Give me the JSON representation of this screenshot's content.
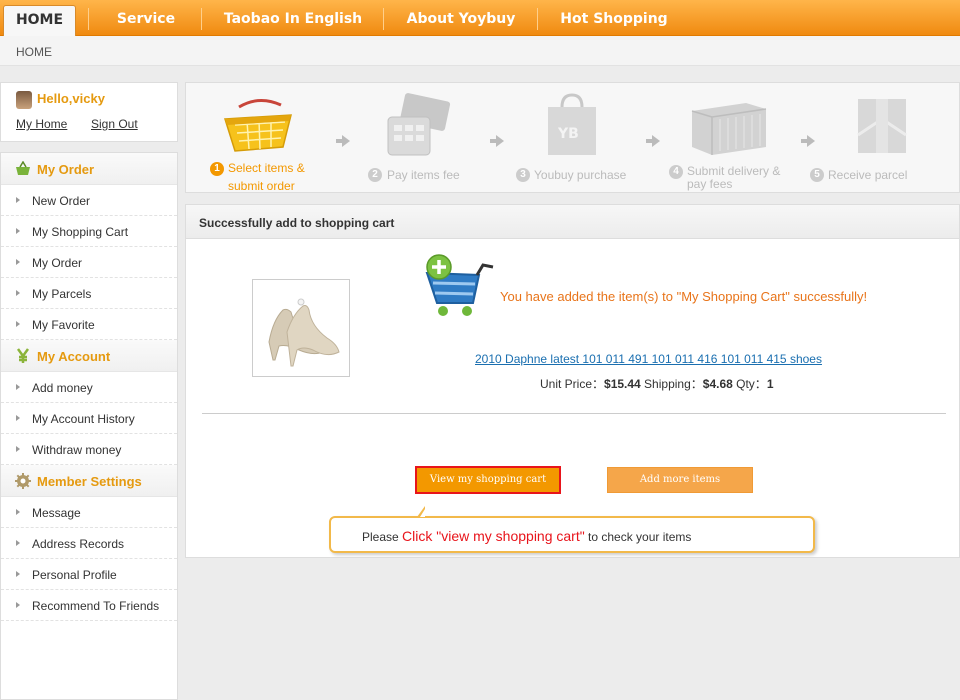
{
  "nav": {
    "tabs": [
      {
        "label": "HOME"
      },
      {
        "label": "Service"
      },
      {
        "label": "Taobao In English"
      },
      {
        "label": "About Yoybuy"
      },
      {
        "label": "Hot Shopping"
      }
    ]
  },
  "breadcrumb": "HOME",
  "user": {
    "greeting": "Hello,vicky",
    "my_home": "My Home",
    "sign_out": "Sign Out"
  },
  "sidebar": {
    "sections": [
      {
        "title": "My Order",
        "icon": "basket-icon",
        "items": [
          "New Order",
          "My Shopping Cart",
          "My Order",
          "My Parcels",
          "My Favorite"
        ]
      },
      {
        "title": "My Account",
        "icon": "yen-icon",
        "items": [
          "Add money",
          "My Account History",
          "Withdraw money"
        ]
      },
      {
        "title": "Member Settings",
        "icon": "gear-icon",
        "items": [
          "Message",
          "Address Records",
          "Personal Profile",
          "Recommend To Friends"
        ]
      }
    ]
  },
  "steps": [
    {
      "num": "1",
      "label": "Select items &",
      "label2": "submit order",
      "active": true
    },
    {
      "num": "2",
      "label": "Pay items fee",
      "label2": "",
      "active": false
    },
    {
      "num": "3",
      "label": "Youbuy purchase",
      "label2": "",
      "active": false
    },
    {
      "num": "4",
      "label": "Submit delivery &",
      "label2": "pay fees",
      "active": false
    },
    {
      "num": "5",
      "label": "Receive parcel",
      "label2": "",
      "active": false
    }
  ],
  "main": {
    "heading": "Successfully add to shopping cart",
    "success_msg": "You have added the item(s) to \"My Shopping Cart\" successfully!",
    "product_name": "2010 Daphne latest 101 011 491 101 011 416 101 011 415 shoes",
    "unit_price_label": "Unit Price：",
    "unit_price": "$15.44",
    "shipping_label": " Shipping：",
    "shipping": "$4.68",
    "qty_label": " Qty：",
    "qty": "1",
    "view_cart_btn": "View my shopping cart",
    "add_more_btn": "Add more items",
    "tip_prefix": "Please ",
    "tip_highlight": "Click \"view my shopping cart\"",
    "tip_suffix": " to check your items"
  },
  "colors": {
    "accent_orange": "#f39800",
    "title_orange": "#e59a10",
    "highlight_red": "#e8141b",
    "link_blue": "#1a6fb0"
  }
}
